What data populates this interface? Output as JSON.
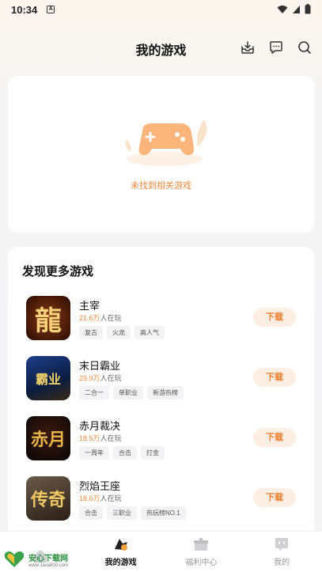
{
  "status": {
    "time": "10:34",
    "a_badge": "A"
  },
  "header": {
    "title": "我的游戏",
    "icons": [
      "download-box-icon",
      "chat-bubble-icon",
      "search-icon"
    ]
  },
  "empty": {
    "message": "未找到相关游戏"
  },
  "discover": {
    "title": "发现更多游戏",
    "download_label": "下载",
    "games": [
      {
        "name": "主宰",
        "players_num": "21.6万",
        "players_suffix": "人在玩",
        "tags": [
          "复古",
          "火龙",
          "高人气"
        ],
        "icon_text": "龍",
        "icon_name": "dragon-character-icon"
      },
      {
        "name": "末日霸业",
        "players_num": "29.9万",
        "players_suffix": "人在玩",
        "tags": [
          "二合一",
          "单职业",
          "新游热榜"
        ],
        "icon_text": "霸业",
        "icon_name": "doomsday-icon"
      },
      {
        "name": "赤月裁决",
        "players_num": "18.5万",
        "players_suffix": "人在玩",
        "tags": [
          "一周年",
          "合击",
          "打金"
        ],
        "icon_text": "赤月",
        "icon_name": "red-moon-icon"
      },
      {
        "name": "烈焰王座",
        "players_num": "18.6万",
        "players_suffix": "人在玩",
        "tags": [
          "合击",
          "三职业",
          "热玩榜NO.1"
        ],
        "icon_text": "传奇",
        "icon_name": "legend-icon"
      }
    ]
  },
  "nav": {
    "items": [
      {
        "label": "",
        "icon": "home-icon"
      },
      {
        "label": "我的游戏",
        "icon": "my-games-icon",
        "active": true
      },
      {
        "label": "福利中心",
        "icon": "gift-icon"
      },
      {
        "label": "我的",
        "icon": "profile-icon"
      }
    ]
  },
  "watermark": {
    "line1": "安心下载网",
    "line2": "www.Java800.com"
  },
  "colors": {
    "accent": "#f08a3c",
    "download_bg": "#fdeee3",
    "card_bg": "#ffffff"
  }
}
